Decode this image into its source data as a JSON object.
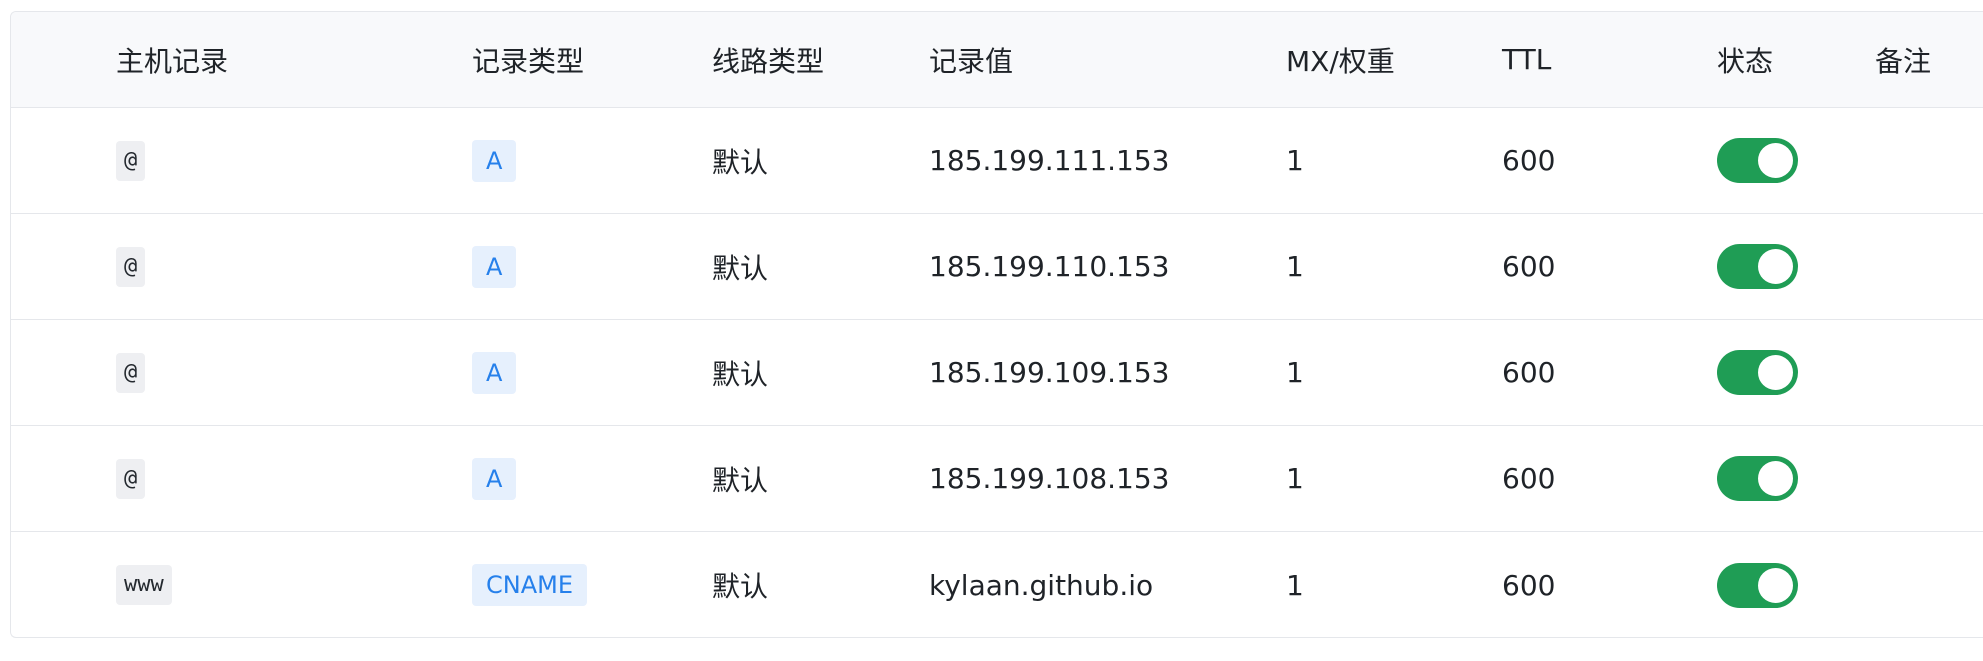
{
  "colors": {
    "toggle_on": "#1f9d55",
    "badge_bg": "#e6f0fd",
    "badge_text": "#2680eb",
    "header_bg": "#f8f9fb"
  },
  "header": {
    "host": "主机记录",
    "type": "记录类型",
    "line": "线路类型",
    "value": "记录值",
    "mx": "MX/权重",
    "ttl": "TTL",
    "status": "状态",
    "note": "备注"
  },
  "rows": [
    {
      "host": "@",
      "type": "A",
      "line": "默认",
      "value": "185.199.111.153",
      "mx": "1",
      "ttl": "600",
      "enabled": true
    },
    {
      "host": "@",
      "type": "A",
      "line": "默认",
      "value": "185.199.110.153",
      "mx": "1",
      "ttl": "600",
      "enabled": true
    },
    {
      "host": "@",
      "type": "A",
      "line": "默认",
      "value": "185.199.109.153",
      "mx": "1",
      "ttl": "600",
      "enabled": true
    },
    {
      "host": "@",
      "type": "A",
      "line": "默认",
      "value": "185.199.108.153",
      "mx": "1",
      "ttl": "600",
      "enabled": true
    },
    {
      "host": "www",
      "type": "CNAME",
      "line": "默认",
      "value": "kylaan.github.io",
      "mx": "1",
      "ttl": "600",
      "enabled": true
    }
  ]
}
